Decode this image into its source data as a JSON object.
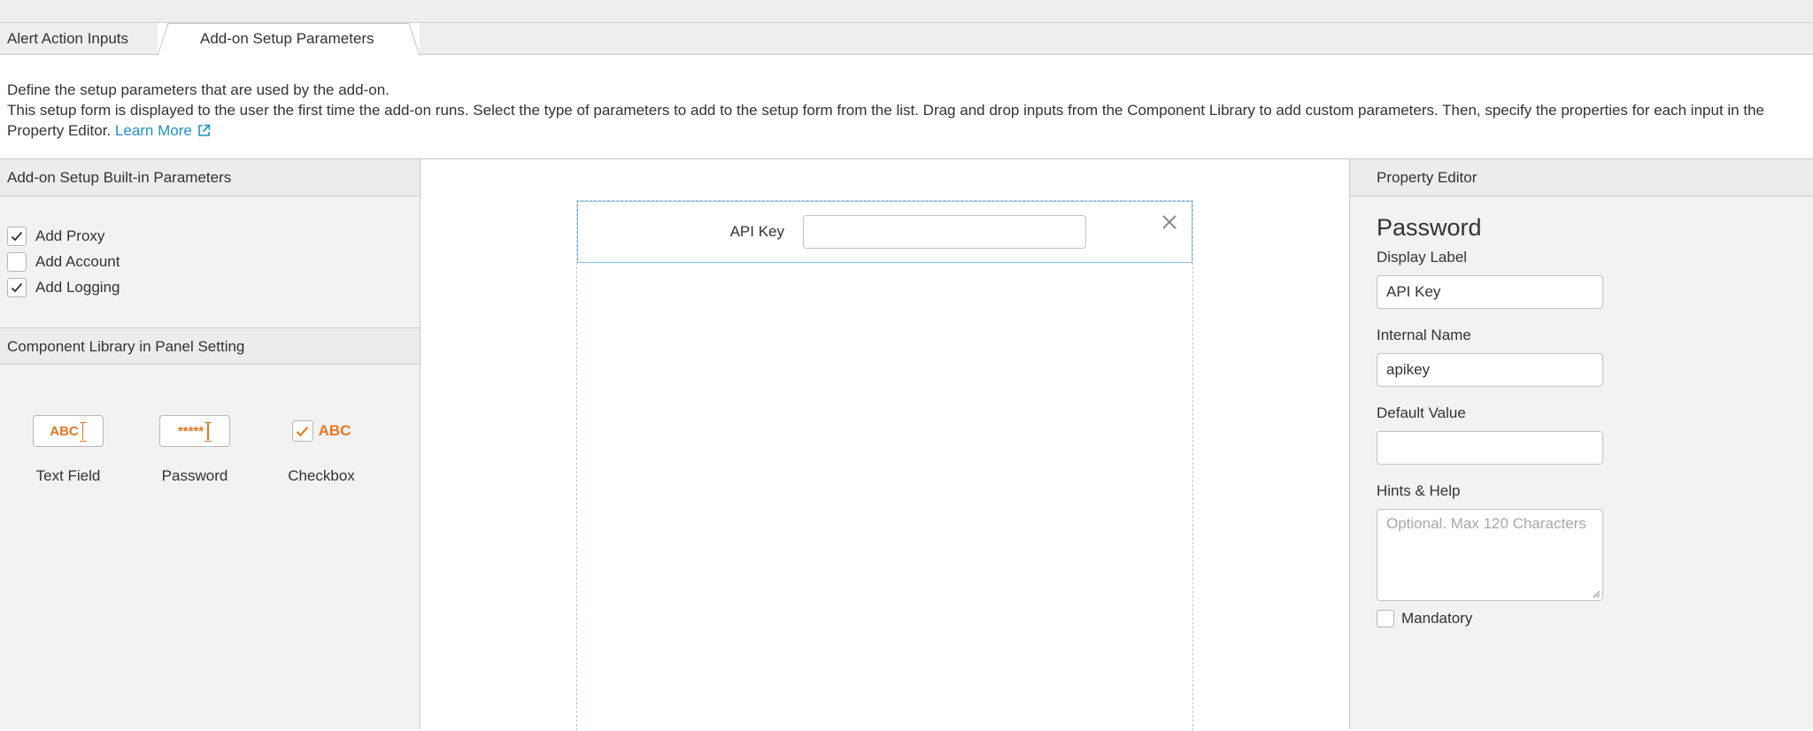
{
  "tabs": {
    "inactive_label": "Alert Action Inputs",
    "active_label": "Add-on Setup Parameters"
  },
  "description": {
    "line1": "Define the setup parameters that are used by the add-on.",
    "line2": "This setup form is displayed to the user the first time the add-on runs. Select the type of parameters to add to the setup form from the list. Drag and drop inputs from the Component Library to add custom parameters. Then, specify the properties for each input in the Property Editor.",
    "learn_more": "Learn More"
  },
  "builtin": {
    "title": "Add-on Setup Built-in Parameters",
    "items": [
      {
        "label": "Add Proxy",
        "checked": true
      },
      {
        "label": "Add Account",
        "checked": false
      },
      {
        "label": "Add Logging",
        "checked": true
      }
    ]
  },
  "library": {
    "title": "Component Library in Panel Setting",
    "components": [
      {
        "name": "Text Field",
        "icon": "text-field-icon",
        "icon_text": "ABC"
      },
      {
        "name": "Password",
        "icon": "password-field-icon",
        "icon_text": "*****"
      },
      {
        "name": "Checkbox",
        "icon": "checkbox-field-icon",
        "icon_text": "ABC"
      }
    ]
  },
  "canvas": {
    "field_label": "API Key"
  },
  "editor": {
    "title": "Property Editor",
    "type": "Password",
    "display_label": {
      "label": "Display Label",
      "value": "API Key"
    },
    "internal_name": {
      "label": "Internal Name",
      "value": "apikey"
    },
    "default_value": {
      "label": "Default Value",
      "value": ""
    },
    "hints": {
      "label": "Hints & Help",
      "placeholder": "Optional. Max 120 Characters"
    },
    "mandatory": {
      "label": "Mandatory",
      "checked": false
    }
  },
  "colors": {
    "accent_orange": "#e87722",
    "link_blue": "#1e93c6",
    "selected_border": "#8fc0de"
  }
}
